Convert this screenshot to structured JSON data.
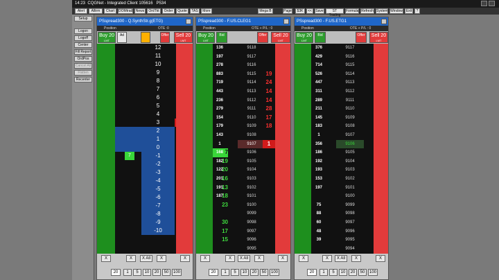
{
  "app": {
    "time": "14:23",
    "title": "CQGNet - Integrated Client 105616",
    "account": "P534"
  },
  "menu": {
    "items": [
      "Alert",
      "Alltrm",
      "Chart",
      "DOMtrad",
      "News",
      "OrdTkt",
      "Order",
      "Quote",
      "TAS",
      "More"
    ],
    "right_items": [
      "Mega B",
      "Page",
      "$3K",
      "<<",
      "Save",
      "ST Trading",
      "Formula",
      "Refresh",
      "System",
      "Window",
      "Exit",
      "?"
    ]
  },
  "left_buttons": [
    "Setup",
    "Logon",
    "Logoff",
    "Center",
    "Fill Report",
    "OrdPos",
    "Cancel All",
    "Flatten",
    "Recenter"
  ],
  "colors": {
    "bid": "#2e9d2e",
    "ask": "#e23b3b",
    "highlight_bid": "#39d639",
    "highlight_ask": "#d11b1b",
    "price_blue": "#1f4f99",
    "window_title": "#1f66c8"
  },
  "windows": [
    {
      "title": "PSspread300 - Q.SynthStr.g(ETG)",
      "header": "Position",
      "header_right": "OTE :0",
      "symbol": "Q.SynthStr...",
      "buy_label": "Buy 20",
      "buy_sub": "LMT",
      "sell_label": "Sell 20",
      "sell_sub": "LMT",
      "mid_labels": [
        "Legs",
        "1:1",
        "ETG1",
        "LMT",
        "DAY",
        "Offer",
        "Bid"
      ],
      "prices": [
        "12",
        "11",
        "10",
        "9",
        "8",
        "7",
        "6",
        "5",
        "4",
        "3",
        "2",
        "1",
        "0",
        "-1",
        "-2",
        "-3",
        "-4",
        "-5",
        "-6",
        "-7",
        "-8",
        "-9",
        "-10"
      ],
      "bids": [
        "",
        "",
        "",
        "",
        "",
        "",
        "",
        "",
        "",
        "",
        "",
        "",
        "",
        "7",
        "",
        "",
        "",
        "",
        "",
        "",
        "",
        "",
        ""
      ],
      "asks": [
        "",
        "",
        "",
        "",
        "",
        "",
        "",
        "",
        "",
        "1",
        "",
        "",
        "",
        "",
        "",
        "",
        "",
        "",
        "",
        "",
        "",
        "",
        ""
      ],
      "footer_qty": "20",
      "footer_buttons": [
        "X",
        "X",
        "X All",
        "X",
        "X"
      ],
      "qty_buttons": [
        "1",
        "5",
        "10",
        "20",
        "50",
        "100"
      ]
    },
    {
      "title": "PSspread300 - F.US.CLEG1",
      "header": "Position",
      "header_right": "OTE + P/L : 0",
      "symbol": "CLEG1",
      "buy_label": "Buy 20",
      "buy_sub": "LMT",
      "sell_label": "Sell 20",
      "sell_sub": "LMT",
      "mid_labels": [
        "Bid",
        "LMT",
        "Offer",
        "LMT"
      ],
      "prices": [
        "9118",
        "9117",
        "9116",
        "9115",
        "9114",
        "9113",
        "9112",
        "9111",
        "9110",
        "9109",
        "9108",
        "9107",
        "9106",
        "9105",
        "9104",
        "9103",
        "9102",
        "9101",
        "9100",
        "9099",
        "9098",
        "9097",
        "9096",
        "9095"
      ],
      "bid_sizes": [
        "",
        "",
        "",
        "",
        "",
        "",
        "",
        "",
        "",
        "",
        "",
        "",
        "7",
        "19",
        "20",
        "16",
        "13",
        "18",
        "23",
        "",
        "30",
        "17",
        "15",
        ""
      ],
      "vol": [
        "136",
        "197",
        "278",
        "883",
        "719",
        "443",
        "236",
        "279",
        "154",
        "179",
        "143",
        "1",
        "168",
        "182",
        "122",
        "201",
        "191",
        "187",
        "",
        "",
        "",
        "",
        "",
        ""
      ],
      "ask_sizes": [
        "",
        "",
        "",
        "19",
        "24",
        "14",
        "14",
        "28",
        "17",
        "18",
        "",
        "1",
        "",
        "",
        "",
        "",
        "",
        "",
        "",
        "",
        "",
        "",
        "",
        ""
      ],
      "footer_qty": "20",
      "footer_buttons": [
        "X",
        "X",
        "X All",
        "X",
        "X"
      ],
      "qty_buttons": [
        "1",
        "5",
        "10",
        "20",
        "50",
        "100"
      ]
    },
    {
      "title": "PSspread300 - F.US.ETG1",
      "header": "Position",
      "header_right": "OTE + P/L : 0",
      "symbol": "ETG1",
      "buy_label": "Buy 20",
      "buy_sub": "LMT",
      "sell_label": "Sell 20",
      "sell_sub": "LMT",
      "mid_labels": [
        "Bid",
        "LMT",
        "Offer",
        "LMT"
      ],
      "prices": [
        "9117",
        "9116",
        "9115",
        "9114",
        "9113",
        "9112",
        "9111",
        "9110",
        "9109",
        "9108",
        "9107",
        "9106",
        "9105",
        "9104",
        "9103",
        "9102",
        "9101",
        "9100",
        "9099",
        "9098",
        "9097",
        "9096",
        "9095",
        "9094"
      ],
      "vol": [
        "376",
        "429",
        "714",
        "526",
        "447",
        "311",
        "289",
        "211",
        "145",
        "183",
        "1",
        "356",
        "186",
        "192",
        "193",
        "153",
        "197",
        "",
        "75",
        "88",
        "60",
        "48",
        "39",
        ""
      ],
      "footer_qty": "20",
      "footer_buttons": [
        "X",
        "X",
        "X All",
        "X",
        "X"
      ],
      "qty_buttons": [
        "1",
        "5",
        "10",
        "20",
        "50",
        "100"
      ]
    }
  ]
}
